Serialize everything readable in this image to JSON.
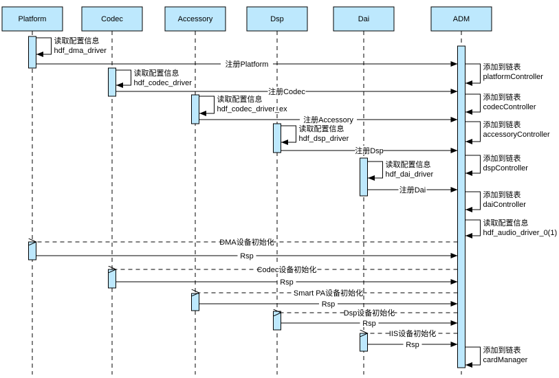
{
  "colors": {
    "box_fill": "#bde8fd",
    "stroke": "#000000"
  },
  "participants": [
    {
      "id": "platform",
      "label": "Platform"
    },
    {
      "id": "codec",
      "label": "Codec"
    },
    {
      "id": "accessory",
      "label": "Accessory"
    },
    {
      "id": "dsp",
      "label": "Dsp"
    },
    {
      "id": "dai",
      "label": "Dai"
    },
    {
      "id": "adm",
      "label": "ADM"
    }
  ],
  "messages": [
    {
      "type": "self",
      "at": "platform",
      "lines": [
        "读取配置信息",
        "hdf_dma_driver"
      ]
    },
    {
      "type": "sync",
      "from": "platform",
      "to": "adm",
      "label": "注册Platform"
    },
    {
      "type": "self",
      "at": "adm",
      "lines": [
        "添加到链表",
        "platformController"
      ]
    },
    {
      "type": "self",
      "at": "codec",
      "lines": [
        "读取配置信息",
        "hdf_codec_driver"
      ]
    },
    {
      "type": "sync",
      "from": "codec",
      "to": "adm",
      "label": "注册Codec"
    },
    {
      "type": "self",
      "at": "adm",
      "lines": [
        "添加到链表",
        "codecController"
      ]
    },
    {
      "type": "self",
      "at": "accessory",
      "lines": [
        "读取配置信息",
        "hdf_codec_driver_ex"
      ]
    },
    {
      "type": "sync",
      "from": "accessory",
      "to": "adm",
      "label": "注册Accessory"
    },
    {
      "type": "self",
      "at": "adm",
      "lines": [
        "添加到链表",
        "accessoryController"
      ]
    },
    {
      "type": "self",
      "at": "dsp",
      "lines": [
        "读取配置信息",
        "hdf_dsp_driver"
      ]
    },
    {
      "type": "sync",
      "from": "dsp",
      "to": "adm",
      "label": "注册Dsp"
    },
    {
      "type": "self",
      "at": "adm",
      "lines": [
        "添加到链表",
        "dspController"
      ]
    },
    {
      "type": "self",
      "at": "dai",
      "lines": [
        "读取配置信息",
        "hdf_dai_driver"
      ]
    },
    {
      "type": "sync",
      "from": "dai",
      "to": "adm",
      "label": "注册Dai"
    },
    {
      "type": "self",
      "at": "adm",
      "lines": [
        "添加到链表",
        "daiController"
      ]
    },
    {
      "type": "self",
      "at": "adm",
      "lines": [
        "读取配置信息",
        "hdf_audio_driver_0(1)"
      ]
    },
    {
      "type": "async",
      "from": "adm",
      "to": "platform",
      "label": "DMA设备初始化"
    },
    {
      "type": "sync",
      "from": "platform",
      "to": "adm",
      "label": "Rsp"
    },
    {
      "type": "async",
      "from": "adm",
      "to": "codec",
      "label": "Codec设备初始化"
    },
    {
      "type": "sync",
      "from": "codec",
      "to": "adm",
      "label": "Rsp"
    },
    {
      "type": "async",
      "from": "adm",
      "to": "accessory",
      "label": "Smart PA设备初始化"
    },
    {
      "type": "sync",
      "from": "accessory",
      "to": "adm",
      "label": "Rsp"
    },
    {
      "type": "async",
      "from": "adm",
      "to": "dsp",
      "label": "Dsp设备初始化"
    },
    {
      "type": "sync",
      "from": "dsp",
      "to": "adm",
      "label": "Rsp"
    },
    {
      "type": "async",
      "from": "adm",
      "to": "dai",
      "label": "IIS设备初始化"
    },
    {
      "type": "sync",
      "from": "dai",
      "to": "adm",
      "label": "Rsp"
    },
    {
      "type": "self",
      "at": "adm",
      "lines": [
        "添加到链表",
        "cardManager"
      ]
    }
  ]
}
